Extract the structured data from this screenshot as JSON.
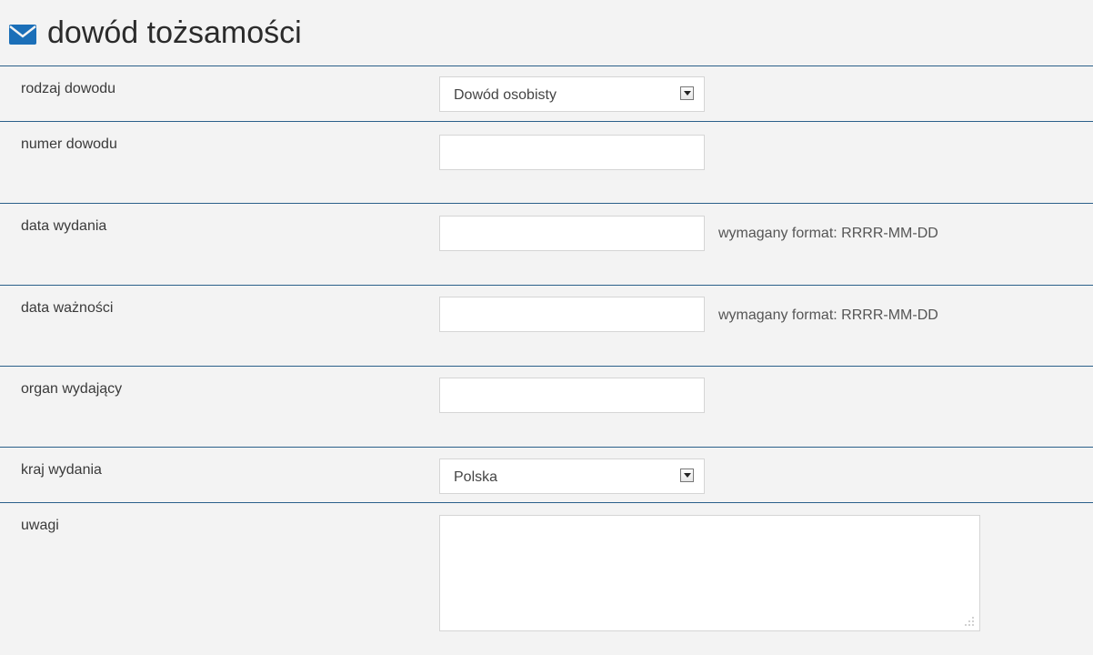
{
  "header": {
    "title": "dowód tożsamości",
    "icon": "envelope-icon",
    "accent_color": "#1b6fb8"
  },
  "form": {
    "rows": [
      {
        "label": "rodzaj dowodu",
        "type": "select",
        "value": "Dowód osobisty"
      },
      {
        "label": "numer dowodu",
        "type": "text",
        "value": ""
      },
      {
        "label": "data wydania",
        "type": "text",
        "value": "",
        "hint": "wymagany format: RRRR-MM-DD"
      },
      {
        "label": "data ważności",
        "type": "text",
        "value": "",
        "hint": "wymagany format: RRRR-MM-DD"
      },
      {
        "label": "organ wydający",
        "type": "text",
        "value": ""
      },
      {
        "label": "kraj wydania",
        "type": "select",
        "value": "Polska"
      },
      {
        "label": "uwagi",
        "type": "textarea",
        "value": ""
      }
    ]
  },
  "colors": {
    "background": "#f3f3f3",
    "divider": "#2a5f8a",
    "field_border": "#d5d5d5"
  }
}
